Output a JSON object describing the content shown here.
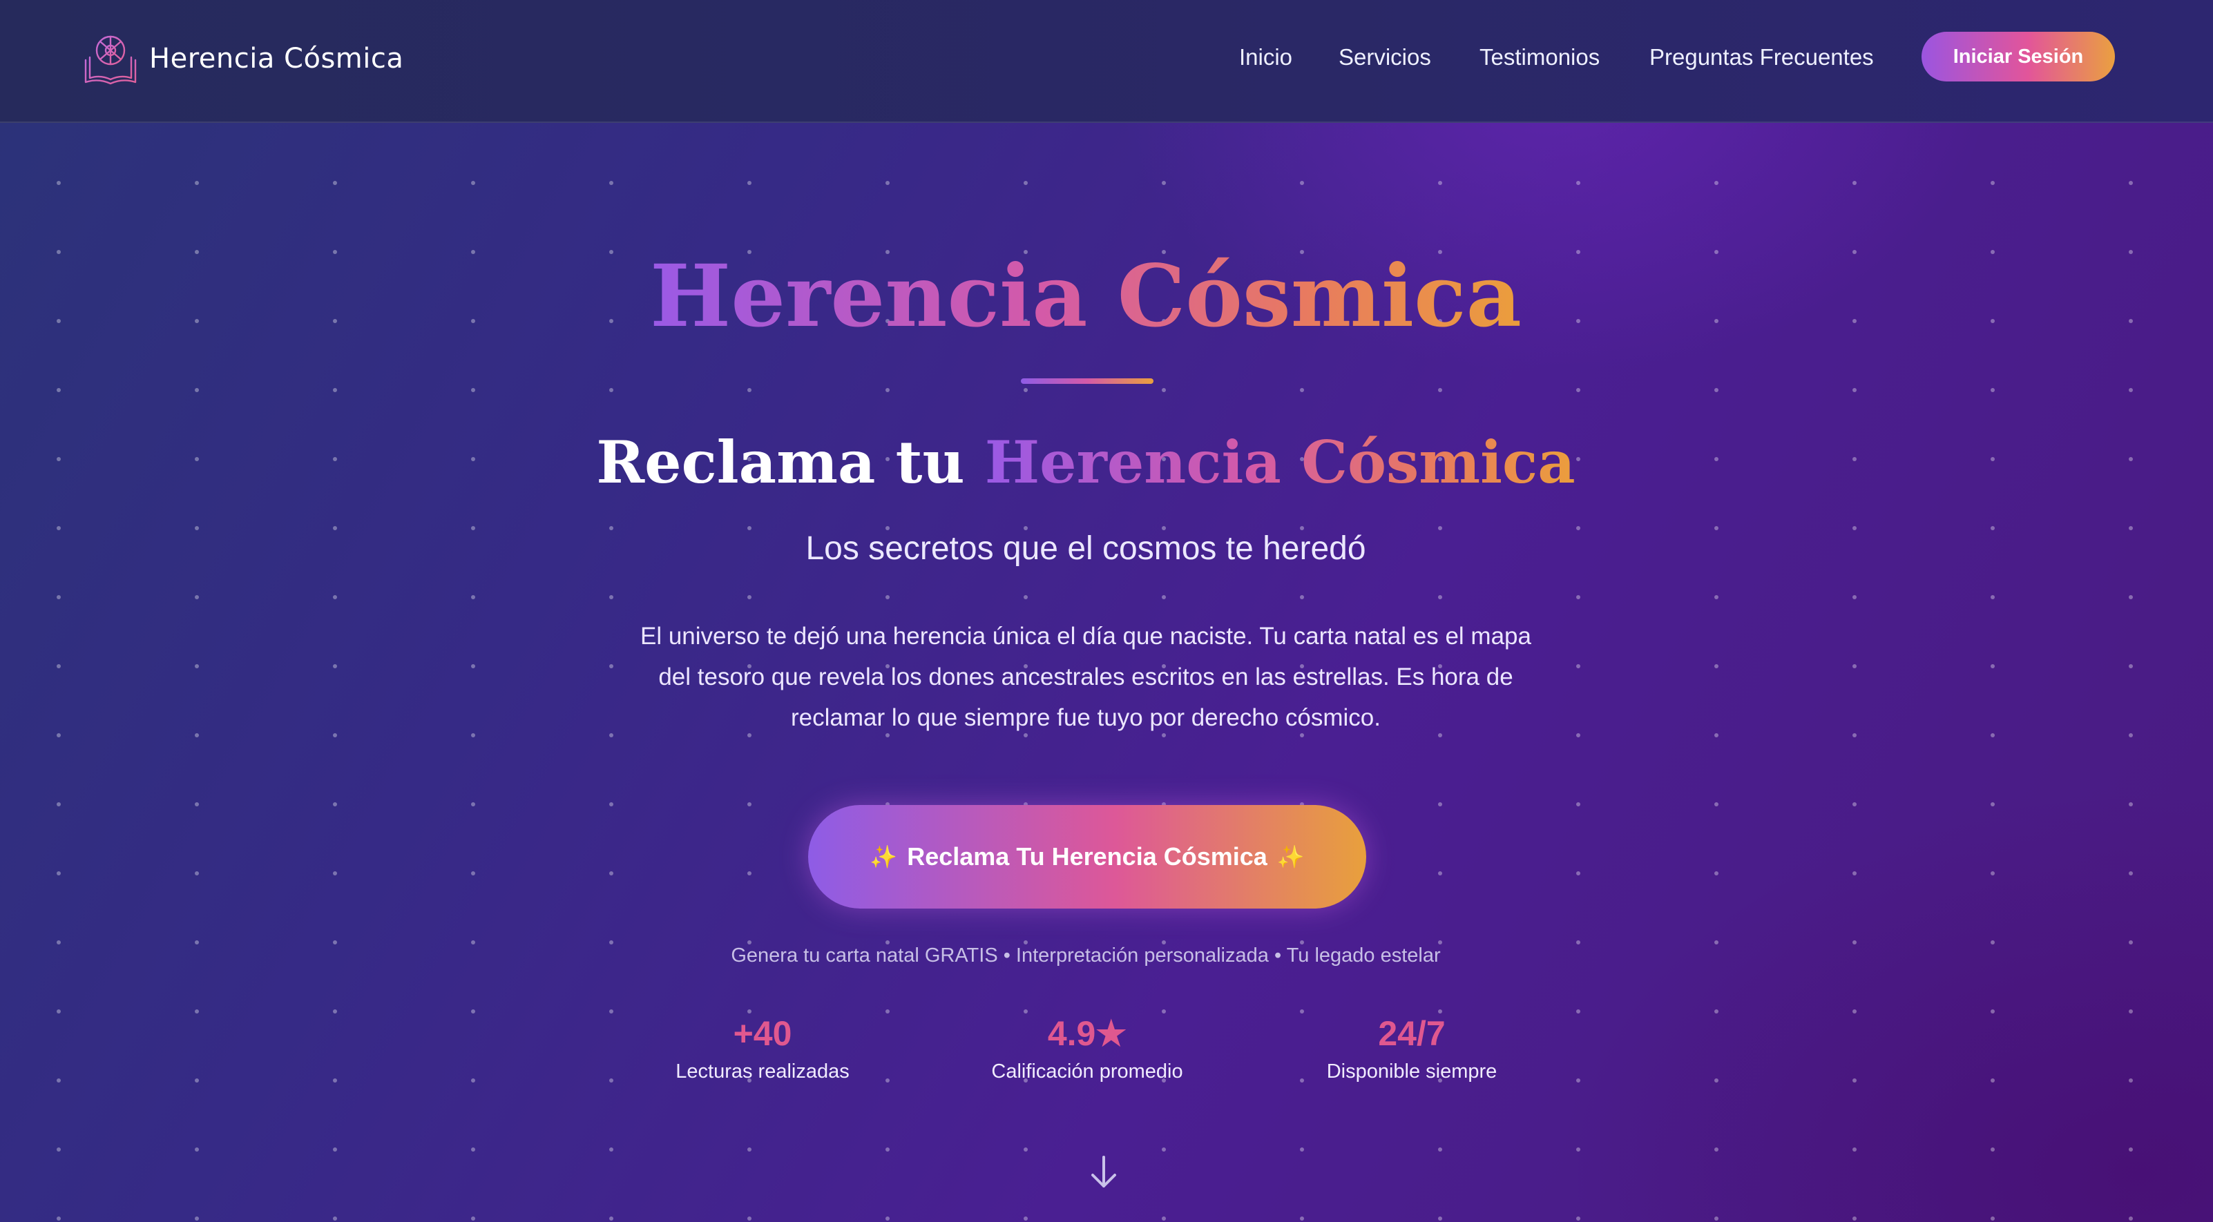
{
  "header": {
    "brand_name": "Herencia Cósmica",
    "brand_icon": "book-compass-icon",
    "nav": [
      {
        "label": "Inicio"
      },
      {
        "label": "Servicios"
      },
      {
        "label": "Testimonios"
      },
      {
        "label": "Preguntas Frecuentes"
      }
    ],
    "login_label": "Iniciar Sesión"
  },
  "hero": {
    "title": "Herencia Cósmica",
    "subheading_plain": "Reclama tu",
    "subheading_accent": "Herencia Cósmica",
    "tagline": "Los secretos que el cosmos te heredó",
    "description": "El universo te dejó una herencia única el día que naciste. Tu carta natal es el mapa del tesoro que revela los dones ancestrales escritos en las estrellas. Es hora de reclamar lo que siempre fue tuyo por derecho cósmico.",
    "cta_label": "Reclama Tu Herencia Cósmica",
    "cta_sparkle": "✨",
    "features_line": "Genera tu carta natal GRATIS • Interpretación personalizada • Tu legado estelar"
  },
  "stats": [
    {
      "value": "+40",
      "label": "Lecturas realizadas"
    },
    {
      "value": "4.9★",
      "label": "Calificación promedio"
    },
    {
      "value": "24/7",
      "label": "Disponible siempre"
    }
  ],
  "scroll_icon": "arrow-down-icon",
  "colors": {
    "accent_purple": "#9b55e0",
    "accent_pink": "#e2559a",
    "accent_orange": "#eaa040",
    "stat_value": "#e0588f",
    "background": "#3a2687"
  }
}
